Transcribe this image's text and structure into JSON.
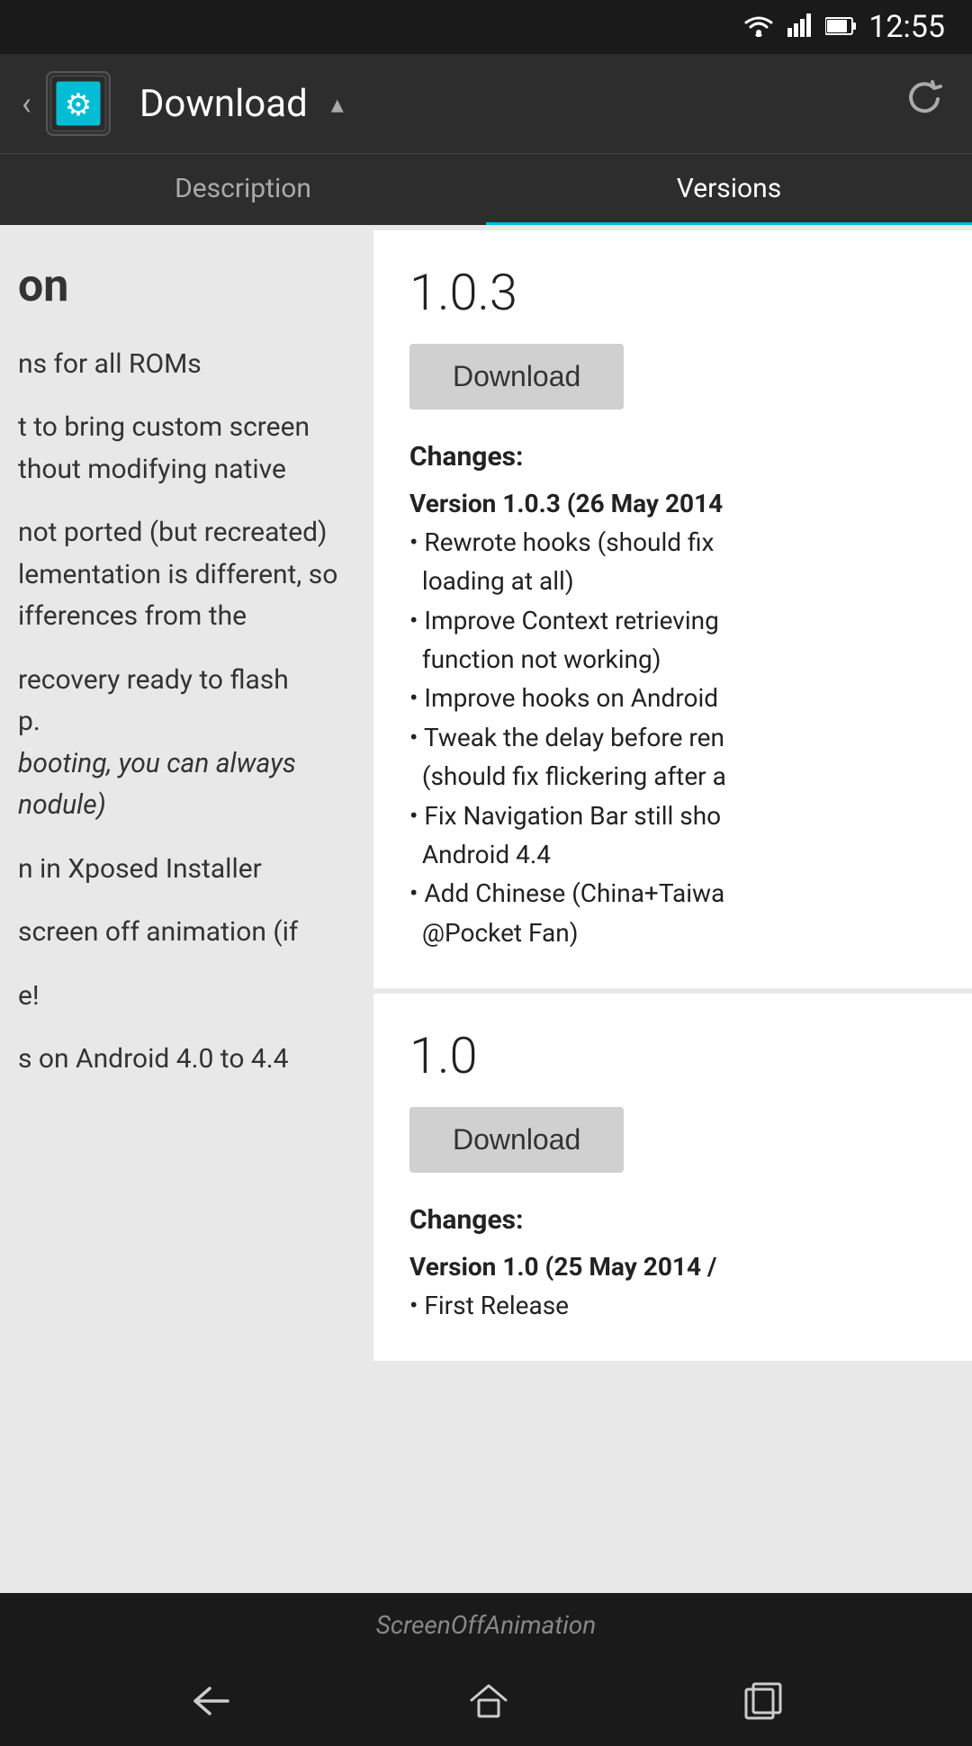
{
  "status_bar": {
    "time": "12:55"
  },
  "app_bar": {
    "title": "Download",
    "back_label": "‹",
    "dropdown_symbol": "▲"
  },
  "tabs": [
    {
      "label": "Description",
      "active": false
    },
    {
      "label": "Versions",
      "active": true
    }
  ],
  "left_panel": {
    "blocks": [
      {
        "id": "block1",
        "text": "on"
      },
      {
        "id": "block2",
        "text": "ns for all ROMs"
      },
      {
        "id": "block3",
        "text": "t to bring custom screen\nthout modifying native"
      },
      {
        "id": "block4",
        "text": "not ported (but recreated)\nlementation is different, so\nifferences from the"
      },
      {
        "id": "block5",
        "text": "recovery ready to flash\np.\nbooting, you can always\nmodule)"
      },
      {
        "id": "block6",
        "text": "n in Xposed Installer"
      },
      {
        "id": "block7",
        "text": "screen off animation (if"
      },
      {
        "id": "block8",
        "text": "e!"
      },
      {
        "id": "block9",
        "text": "s on Android 4.0 to 4.4"
      }
    ]
  },
  "versions": [
    {
      "id": "v103",
      "number": "1.0.3",
      "download_label": "Download",
      "changes_label": "Changes:",
      "changes_version": "Version 1.0.3 (26 May 2014",
      "changes_bullets": [
        "• Rewrote hooks (should fix\nloading at all)",
        "• Improve Context retrieving\nfunction not working)",
        "• Improve hooks on Android",
        "• Tweak the delay before ren\n(should fix flickering after a",
        "• Fix Navigation Bar still sho\nAndroid 4.4",
        "• Add Chinese (China+Taiwa\n@Pocket Fan)"
      ]
    },
    {
      "id": "v10",
      "number": "1.0",
      "download_label": "Download",
      "changes_label": "Changes:",
      "changes_version": "Version 1.0 (25 May 2014 /",
      "changes_bullets": [
        "• First Release"
      ]
    }
  ],
  "bottom_bar": {
    "label": "ScreenOffAnimation"
  },
  "nav_bar": {
    "back_label": "←",
    "home_label": "⌂",
    "recents_label": "▣"
  }
}
